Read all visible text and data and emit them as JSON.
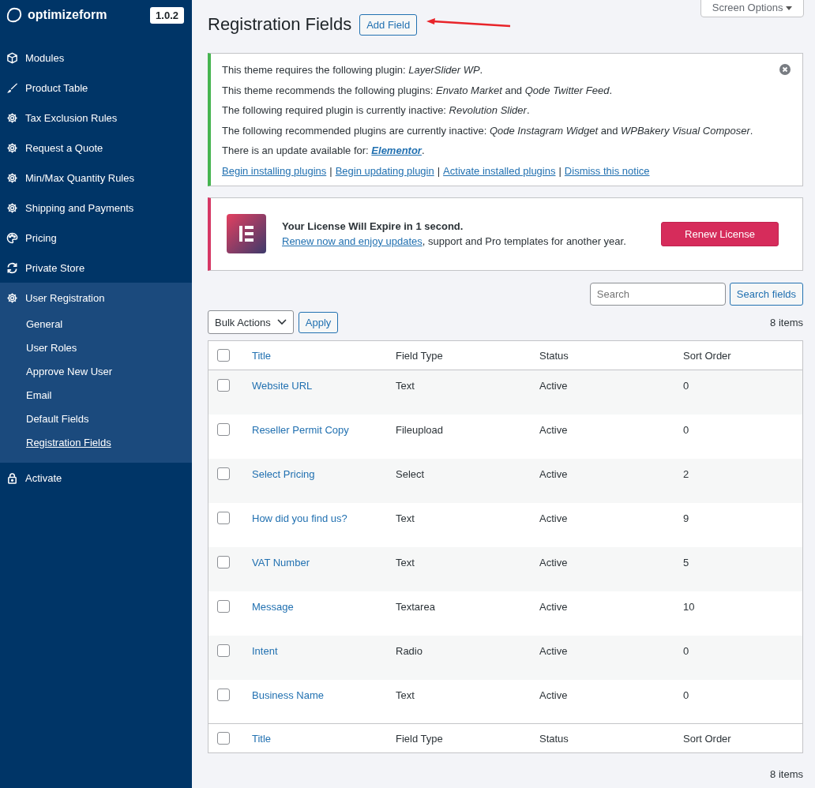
{
  "sidebar": {
    "brand": "optimizeform",
    "version": "1.0.2",
    "items": [
      {
        "label": "Modules",
        "selected": false,
        "expanded": false
      },
      {
        "label": "Product Table",
        "selected": false,
        "expanded": false
      },
      {
        "label": "Tax Exclusion Rules",
        "selected": false,
        "expanded": false
      },
      {
        "label": "Request a Quote",
        "selected": false,
        "expanded": false
      },
      {
        "label": "Min/Max Quantity Rules",
        "selected": false,
        "expanded": false
      },
      {
        "label": "Shipping and Payments",
        "selected": false,
        "expanded": false
      },
      {
        "label": "Pricing",
        "selected": false,
        "expanded": false
      },
      {
        "label": "Private Store",
        "selected": false,
        "expanded": false
      },
      {
        "label": "User Registration",
        "selected": false,
        "expanded": true,
        "children": [
          {
            "label": "General",
            "selected": false
          },
          {
            "label": "User Roles",
            "selected": false
          },
          {
            "label": "Approve New User",
            "selected": false
          },
          {
            "label": "Email",
            "selected": false
          },
          {
            "label": "Default Fields",
            "selected": false
          },
          {
            "label": "Registration Fields",
            "selected": true
          }
        ]
      },
      {
        "label": "Activate",
        "selected": false,
        "expanded": false
      }
    ]
  },
  "screen_options": "Screen Options",
  "page_title": "Registration Fields",
  "add_button": "Add Field",
  "plugin_notice": {
    "lines": [
      {
        "text": "This theme requires the following plugin: *LayerSlider WP*."
      },
      {
        "text": "This theme recommends the following plugins: *Envato Market* and *Qode Twitter Feed*."
      },
      {
        "text": "The following required plugin is currently inactive: *Revolution Slider*."
      },
      {
        "text": "The following recommended plugins are currently inactive: *Qode Instagram Widget* and *WPBakery Visual Composer*."
      },
      {
        "text": "There is an update available for: ",
        "link": "Elementor",
        "after": "."
      }
    ],
    "links": [
      "Begin installing plugins",
      "Begin updating plugin",
      "Activate installed plugins",
      "Dismiss this notice"
    ],
    "separator": "|"
  },
  "license_notice": {
    "title": "Your License Will Expire in 1 second.",
    "link": "Renew now and enjoy updates",
    "text": ", support and Pro templates for another year.",
    "button": "Renew License"
  },
  "search": {
    "placeholder": "Search",
    "button": "Search fields"
  },
  "bulk_actions": {
    "value": "Bulk Actions",
    "apply": "Apply"
  },
  "item_count_top": "8 items",
  "table": {
    "columns": [
      "Title",
      "Field Type",
      "Status",
      "Sort Order"
    ],
    "footer_columns": [
      "Title",
      "Field Type",
      "Status",
      "Sort Order"
    ],
    "header_checked": false,
    "footer_checked": false,
    "rows": [
      {
        "title": "Website URL",
        "type": "Text",
        "status": "Active",
        "order": "0",
        "checked": false
      },
      {
        "title": "Reseller Permit Copy",
        "type": "Fileupload",
        "status": "Active",
        "order": "0",
        "checked": false
      },
      {
        "title": "Select Pricing",
        "type": "Select",
        "status": "Active",
        "order": "2",
        "checked": false
      },
      {
        "title": "How did you find us?",
        "type": "Text",
        "status": "Active",
        "order": "9",
        "checked": false
      },
      {
        "title": "VAT Number",
        "type": "Text",
        "status": "Active",
        "order": "5",
        "checked": false
      },
      {
        "title": "Message",
        "type": "Textarea",
        "status": "Active",
        "order": "10",
        "checked": false
      },
      {
        "title": "Intent",
        "type": "Radio",
        "status": "Active",
        "order": "0",
        "checked": false
      },
      {
        "title": "Business Name",
        "type": "Text",
        "status": "Active",
        "order": "0",
        "checked": false
      }
    ]
  },
  "item_count_bottom": "8 items"
}
